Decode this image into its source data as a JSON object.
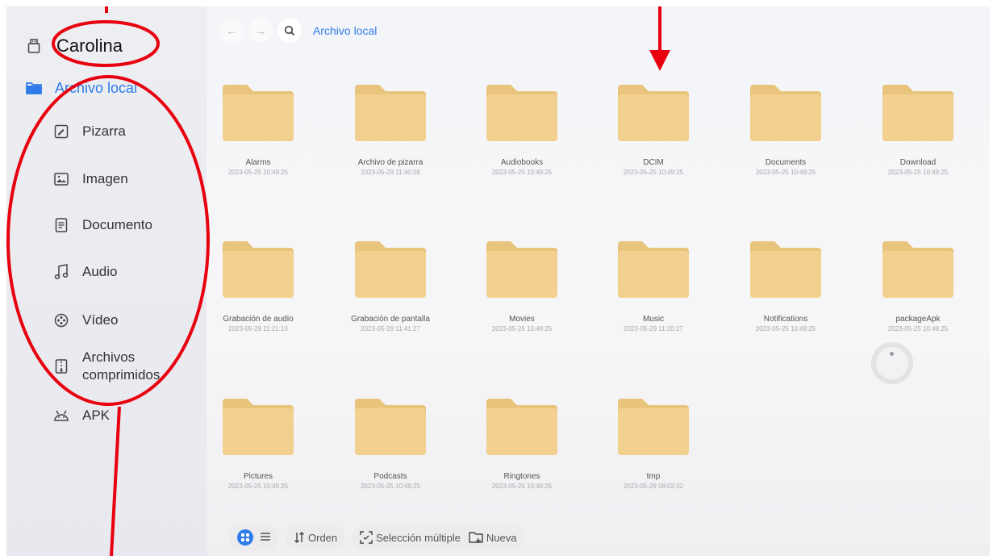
{
  "sidebar": {
    "device": "Carolina",
    "local": "Archivo local",
    "items": [
      {
        "label": "Pizarra",
        "icon": "whiteboard-icon"
      },
      {
        "label": "Imagen",
        "icon": "image-icon"
      },
      {
        "label": "Documento",
        "icon": "document-icon"
      },
      {
        "label": "Audio",
        "icon": "music-icon"
      },
      {
        "label": "Vídeo",
        "icon": "video-icon"
      },
      {
        "label": "Archivos comprimidos",
        "icon": "archive-icon"
      },
      {
        "label": "APK",
        "icon": "android-icon"
      }
    ]
  },
  "toolbar": {
    "back": "←",
    "forward": "→",
    "breadcrumb": "Archivo local"
  },
  "folders": [
    {
      "name": "Alarms",
      "date": "2023-05-25 10:49:25"
    },
    {
      "name": "Archivo de pizarra",
      "date": "2023-05-29 11:40:28"
    },
    {
      "name": "Audiobooks",
      "date": "2023-05-25 10:49:25"
    },
    {
      "name": "DCIM",
      "date": "2023-05-25 10:49:25"
    },
    {
      "name": "Documents",
      "date": "2023-05-25 10:49:25"
    },
    {
      "name": "Download",
      "date": "2023-05-25 10:49:25"
    },
    {
      "name": "Grabación de audio",
      "date": "2023-05-29 11:21:10"
    },
    {
      "name": "Grabación de pantalla",
      "date": "2023-05-29 11:41:27"
    },
    {
      "name": "Movies",
      "date": "2023-05-25 10:49:25"
    },
    {
      "name": "Music",
      "date": "2023-05-29 11:20:27"
    },
    {
      "name": "Notifications",
      "date": "2023-05-25 10:49:25"
    },
    {
      "name": "packageApk",
      "date": "2023-05-25 10:49:25"
    },
    {
      "name": "Pictures",
      "date": "2023-05-25 10:49:25"
    },
    {
      "name": "Podcasts",
      "date": "2023-05-25 10:49:25"
    },
    {
      "name": "Ringtones",
      "date": "2023-05-25 10:49:25"
    },
    {
      "name": "tmp",
      "date": "2023-05-29 08:02:32"
    }
  ],
  "bottombar": {
    "sort": "Orden",
    "multi": "Selección múltiple",
    "new": "Nueva"
  },
  "colors": {
    "accent": "#2f7be9",
    "folder": "#f2d08f",
    "annotation": "#e8000f"
  }
}
